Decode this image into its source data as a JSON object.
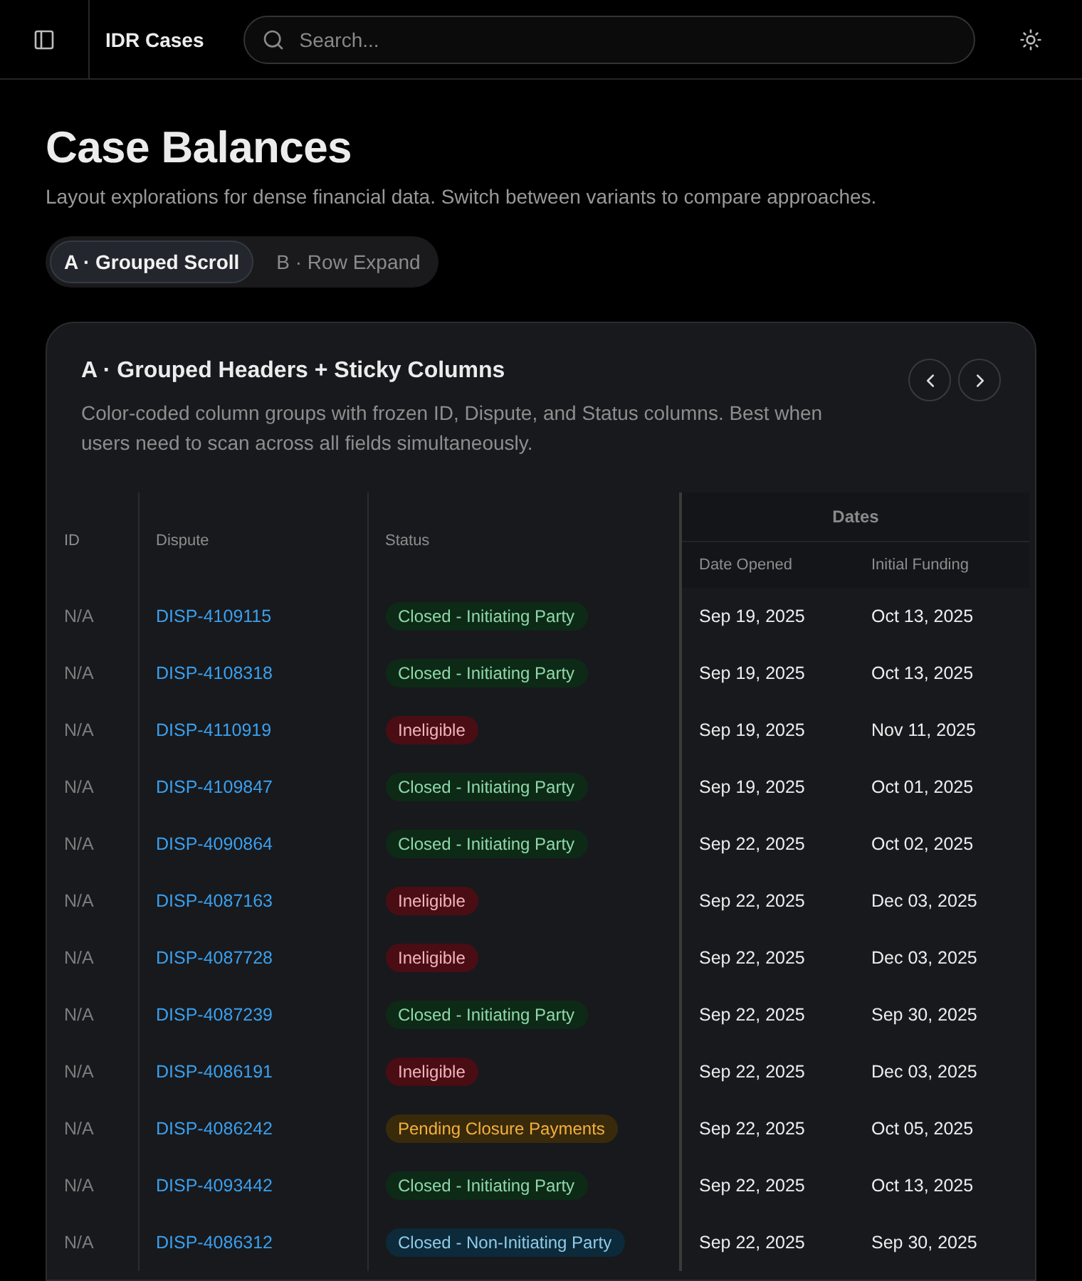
{
  "topbar": {
    "title": "IDR Cases",
    "search": {
      "placeholder": "Search..."
    }
  },
  "page": {
    "title": "Case Balances",
    "subtitle": "Layout explorations for dense financial data. Switch between variants to compare approaches."
  },
  "variants": [
    {
      "label": "A · Grouped Scroll",
      "selected": true
    },
    {
      "label": "B · Row Expand",
      "selected": false
    }
  ],
  "card": {
    "title": "A · Grouped Headers + Sticky Columns",
    "description": "Color-coded column groups with frozen ID, Dispute, and Status columns. Best when users need to scan across all fields simultaneously."
  },
  "table": {
    "columns": [
      "ID",
      "Dispute",
      "Status"
    ],
    "group": "Dates",
    "group_columns": [
      "Date Opened",
      "Initial Funding"
    ],
    "rows": [
      {
        "id": "N/A",
        "dispute": "DISP-4109115",
        "status": "Closed - Initiating Party",
        "kind": "closed",
        "opened": "Sep 19, 2025",
        "funding": "Oct 13, 2025"
      },
      {
        "id": "N/A",
        "dispute": "DISP-4108318",
        "status": "Closed - Initiating Party",
        "kind": "closed",
        "opened": "Sep 19, 2025",
        "funding": "Oct 13, 2025"
      },
      {
        "id": "N/A",
        "dispute": "DISP-4110919",
        "status": "Ineligible",
        "kind": "ineligible",
        "opened": "Sep 19, 2025",
        "funding": "Nov 11, 2025"
      },
      {
        "id": "N/A",
        "dispute": "DISP-4109847",
        "status": "Closed - Initiating Party",
        "kind": "closed",
        "opened": "Sep 19, 2025",
        "funding": "Oct 01, 2025"
      },
      {
        "id": "N/A",
        "dispute": "DISP-4090864",
        "status": "Closed - Initiating Party",
        "kind": "closed",
        "opened": "Sep 22, 2025",
        "funding": "Oct 02, 2025"
      },
      {
        "id": "N/A",
        "dispute": "DISP-4087163",
        "status": "Ineligible",
        "kind": "ineligible",
        "opened": "Sep 22, 2025",
        "funding": "Dec 03, 2025"
      },
      {
        "id": "N/A",
        "dispute": "DISP-4087728",
        "status": "Ineligible",
        "kind": "ineligible",
        "opened": "Sep 22, 2025",
        "funding": "Dec 03, 2025"
      },
      {
        "id": "N/A",
        "dispute": "DISP-4087239",
        "status": "Closed - Initiating Party",
        "kind": "closed",
        "opened": "Sep 22, 2025",
        "funding": "Sep 30, 2025"
      },
      {
        "id": "N/A",
        "dispute": "DISP-4086191",
        "status": "Ineligible",
        "kind": "ineligible",
        "opened": "Sep 22, 2025",
        "funding": "Dec 03, 2025"
      },
      {
        "id": "N/A",
        "dispute": "DISP-4086242",
        "status": "Pending Closure Payments",
        "kind": "pending",
        "opened": "Sep 22, 2025",
        "funding": "Oct 05, 2025"
      },
      {
        "id": "N/A",
        "dispute": "DISP-4093442",
        "status": "Closed - Initiating Party",
        "kind": "closed",
        "opened": "Sep 22, 2025",
        "funding": "Oct 13, 2025"
      },
      {
        "id": "N/A",
        "dispute": "DISP-4086312",
        "status": "Closed - Non-Initiating Party",
        "kind": "nonparty",
        "opened": "Sep 22, 2025",
        "funding": "Sep 30, 2025"
      }
    ]
  }
}
